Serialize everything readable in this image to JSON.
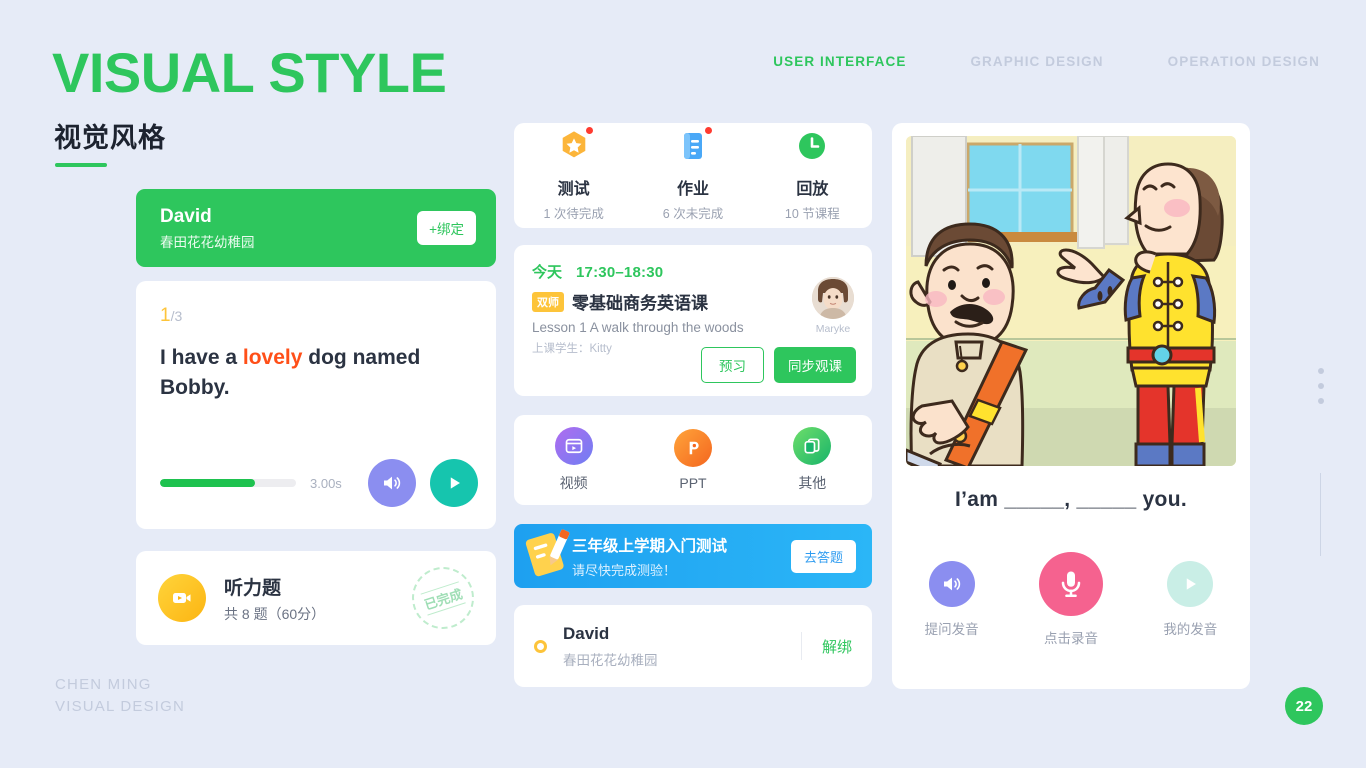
{
  "header": {
    "title_en": "VISUAL STYLE",
    "title_cn": "视觉风格",
    "nav": [
      {
        "label": "USER INTERFACE",
        "active": true
      },
      {
        "label": "GRAPHIC DESIGN",
        "active": false
      },
      {
        "label": "OPERATION DESIGN",
        "active": false
      }
    ]
  },
  "footer": {
    "line1": "CHEN MING",
    "line2": "VISUAL DESIGN",
    "page_number": "22"
  },
  "colors": {
    "background": "#e6ebf7",
    "brand_green": "#2ec65d",
    "accent_yellow": "#fdc43a",
    "accent_orange": "#ff4f18",
    "accent_blue": "#2bb6f7",
    "purple": "#8b8ef0",
    "teal": "#16c5ae",
    "pink": "#f5628f"
  },
  "left": {
    "user_banner": {
      "name": "David",
      "school": "春田花花幼稚园",
      "bind_button": "+绑定"
    },
    "sentence_card": {
      "current": "1",
      "total": "/3",
      "text_before": "I have a ",
      "text_highlight": "lovely",
      "text_after": " dog named Bobby.",
      "duration": "3.00s",
      "progress_percent": 70,
      "speaker_icon": "speaker-icon",
      "play_icon": "play-icon"
    },
    "listening_card": {
      "icon": "video-play-icon",
      "title": "听力题",
      "subtitle": "共 8 题（60分）",
      "stamp": "已完成"
    }
  },
  "middle": {
    "quick_actions": [
      {
        "icon": "star-badge-icon",
        "label": "测试",
        "sub": "1 次待完成",
        "badge": true
      },
      {
        "icon": "homework-doc-icon",
        "label": "作业",
        "sub": "6 次未完成",
        "badge": true
      },
      {
        "icon": "clock-icon",
        "label": "回放",
        "sub": "10 节课程",
        "badge": false
      }
    ],
    "lesson_card": {
      "day": "今天",
      "time": "17:30–18:30",
      "tag": "双师",
      "course": "零基础商务英语课",
      "lesson": "Lesson 1  A walk through the woods",
      "student_label": "上课学生：",
      "student_name": "Kitty",
      "teacher_name": "Maryke",
      "btn_preview": "预习",
      "btn_join": "同步观课"
    },
    "resources": [
      {
        "icon": "video-icon",
        "label": "视频"
      },
      {
        "icon": "ppt-icon",
        "label": "PPT"
      },
      {
        "icon": "other-files-icon",
        "label": "其他"
      }
    ],
    "promo": {
      "icon": "test-paper-pencil-icon",
      "title": "三年级上学期入门测试",
      "subtitle": "请尽快完成测验！",
      "button": "去答题"
    },
    "bound_account": {
      "status_icon": "ring-indicator-icon",
      "name": "David",
      "school": "春田花花幼稚园",
      "action": "解绑"
    }
  },
  "right": {
    "illustration_alt": "cartoon-two-characters-illustration",
    "sentence": "I’am _____, _____ you.",
    "actions": [
      {
        "icon": "speaker-icon",
        "label": "提问发音"
      },
      {
        "icon": "microphone-icon",
        "label": "点击录音"
      },
      {
        "icon": "play-icon",
        "label": "我的发音"
      }
    ]
  }
}
